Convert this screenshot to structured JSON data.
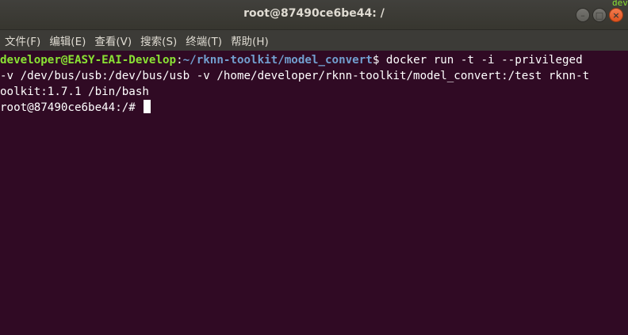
{
  "window": {
    "title": "root@87490ce6be44: /",
    "peek_text": "dev"
  },
  "menu": {
    "items": [
      {
        "label": "文件(F)"
      },
      {
        "label": "编辑(E)"
      },
      {
        "label": "查看(V)"
      },
      {
        "label": "搜索(S)"
      },
      {
        "label": "终端(T)"
      },
      {
        "label": "帮助(H)"
      }
    ]
  },
  "terminal": {
    "prompt_user_host": "developer@EASY-EAI-Develop",
    "prompt_colon": ":",
    "prompt_path": "~/rknn-toolkit/model_convert",
    "prompt_symbol": "$ ",
    "command_line_1": "docker run -t -i --privileged",
    "command_line_2": "-v /dev/bus/usb:/dev/bus/usb -v /home/developer/rknn-toolkit/model_convert:/test rknn-t",
    "command_line_3": "oolkit:1.7.1 /bin/bash",
    "root_prompt": "root@87490ce6be44:/# "
  },
  "colors": {
    "terminal_bg": "#300a24",
    "prompt_user": "#8ae234",
    "prompt_path": "#729fcf",
    "close_button": "#e95420"
  }
}
